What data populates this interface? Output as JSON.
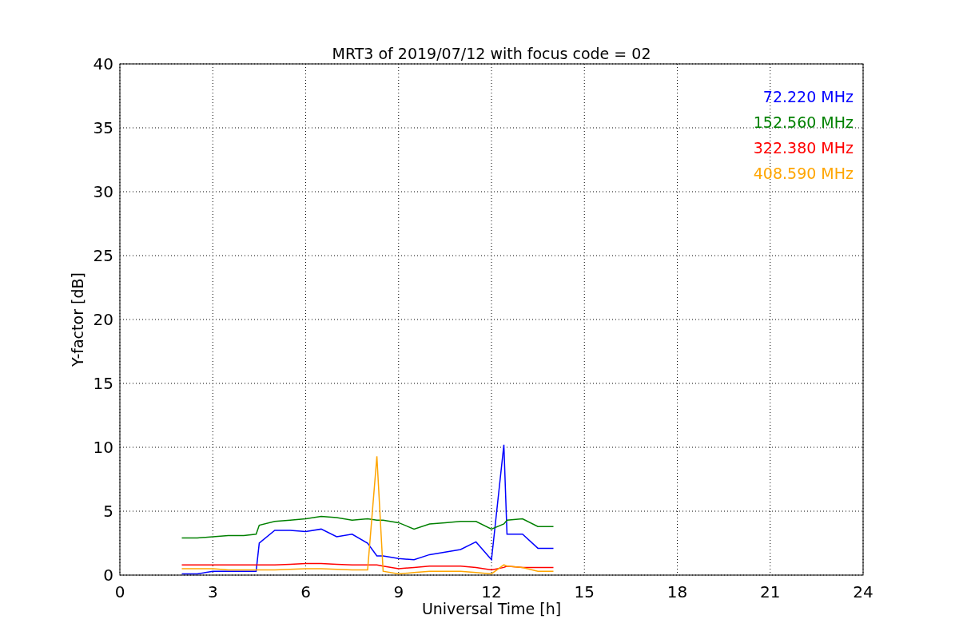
{
  "chart_data": {
    "type": "line",
    "title": "MRT3 of 2019/07/12 with focus code = 02",
    "xlabel": "Universal Time [h]",
    "ylabel": "Y-factor [dB]",
    "x": [
      2,
      2.5,
      3,
      3.5,
      4,
      4.4,
      4.5,
      5,
      5.5,
      6,
      6.5,
      7,
      7.5,
      8,
      8.3,
      8.5,
      9,
      9.5,
      10,
      10.5,
      11,
      11.5,
      12,
      12.4,
      12.5,
      13,
      13.5,
      14
    ],
    "series": [
      {
        "name": "72.220 MHz",
        "color": "#0000ff",
        "values": [
          0.1,
          0.1,
          0.3,
          0.3,
          0.3,
          0.3,
          2.5,
          3.5,
          3.5,
          3.4,
          3.6,
          3.0,
          3.2,
          2.5,
          1.5,
          1.5,
          1.3,
          1.2,
          1.6,
          1.8,
          2.0,
          2.6,
          1.2,
          10.2,
          3.2,
          3.2,
          2.1,
          2.1
        ]
      },
      {
        "name": "152.560 MHz",
        "color": "#008000",
        "values": [
          2.9,
          2.9,
          3.0,
          3.1,
          3.1,
          3.2,
          3.9,
          4.2,
          4.3,
          4.4,
          4.6,
          4.5,
          4.3,
          4.4,
          4.3,
          4.3,
          4.1,
          3.6,
          4.0,
          4.1,
          4.2,
          4.2,
          3.6,
          4.0,
          4.3,
          4.4,
          3.8,
          3.8
        ]
      },
      {
        "name": "322.380 MHz",
        "color": "#ff0000",
        "values": [
          0.8,
          0.8,
          0.8,
          0.8,
          0.8,
          0.8,
          0.8,
          0.8,
          0.85,
          0.9,
          0.9,
          0.85,
          0.8,
          0.8,
          0.8,
          0.7,
          0.5,
          0.6,
          0.7,
          0.7,
          0.7,
          0.6,
          0.4,
          0.6,
          0.7,
          0.6,
          0.6,
          0.6
        ]
      },
      {
        "name": "408.590 MHz",
        "color": "#ffa500",
        "values": [
          0.5,
          0.5,
          0.5,
          0.4,
          0.4,
          0.4,
          0.4,
          0.4,
          0.45,
          0.5,
          0.5,
          0.45,
          0.4,
          0.4,
          9.3,
          0.3,
          0.1,
          0.2,
          0.3,
          0.3,
          0.3,
          0.2,
          0.1,
          0.8,
          0.7,
          0.6,
          0.3,
          0.3
        ]
      }
    ],
    "grid": true,
    "xlim": [
      0,
      24
    ],
    "ylim": [
      0,
      40
    ],
    "xticks": [
      0,
      3,
      6,
      9,
      12,
      15,
      18,
      21,
      24
    ],
    "yticks": [
      0,
      5,
      10,
      15,
      20,
      25,
      30,
      35,
      40
    ]
  }
}
